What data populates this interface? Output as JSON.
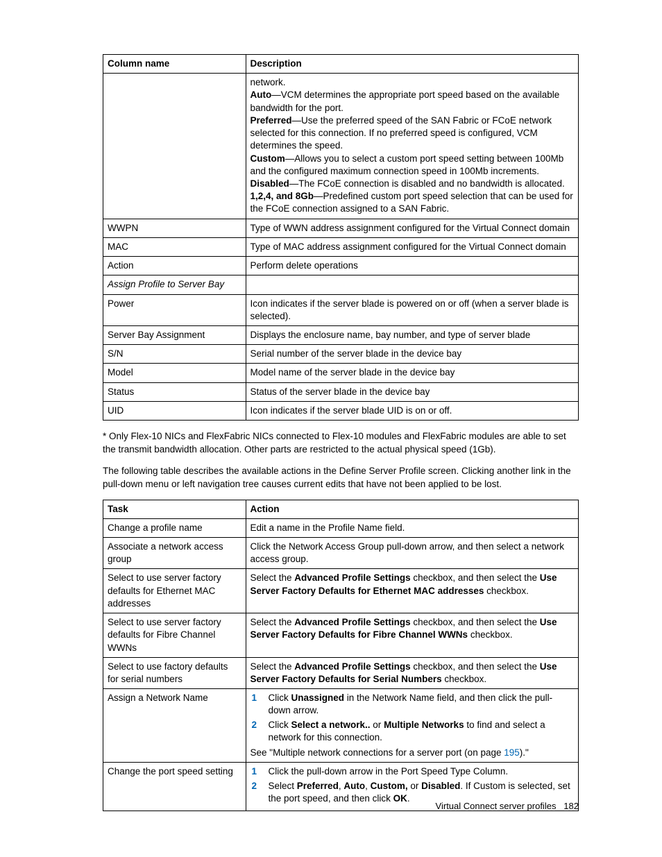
{
  "table1": {
    "headers": {
      "col1": "Column name",
      "col2": "Description"
    },
    "rows": [
      {
        "col1": "",
        "desc_plain1": "network.",
        "auto_label": "Auto",
        "auto_text": "—VCM determines the appropriate port speed based on the available bandwidth for the port.",
        "pref_label": "Preferred",
        "pref_text": "—Use the preferred speed of the SAN Fabric or FCoE network selected for this connection. If no preferred speed is configured, VCM determines the speed.",
        "custom_label": "Custom",
        "custom_text": "—Allows you to select a custom port speed setting between 100Mb and the configured maximum connection speed in 100Mb increments.",
        "disabled_label": "Disabled",
        "disabled_text": "—The FCoE connection is disabled and no bandwidth is allocated.",
        "gb_label": "1,2,4, and 8Gb",
        "gb_text": "—Predefined custom port speed selection that can be used for the FCoE connection assigned to a SAN Fabric."
      },
      {
        "col1": "WWPN",
        "col2": "Type of WWN address assignment configured for the Virtual Connect domain"
      },
      {
        "col1": "MAC",
        "col2": "Type of MAC address assignment configured for the Virtual Connect domain"
      },
      {
        "col1": "Action",
        "col2": "Perform delete operations"
      },
      {
        "col1": "Assign Profile to Server Bay",
        "col2": "",
        "italic": true
      },
      {
        "col1": "Power",
        "col2": "Icon indicates if the server blade is powered on or off (when a server blade is selected)."
      },
      {
        "col1": "Server Bay Assignment",
        "col2": "Displays the enclosure name, bay number, and type of server blade"
      },
      {
        "col1": "S/N",
        "col2": "Serial number of the server blade in the device bay"
      },
      {
        "col1": "Model",
        "col2": "Model name of the server blade in the device bay"
      },
      {
        "col1": "Status",
        "col2": "Status of the server blade in the device bay"
      },
      {
        "col1": "UID",
        "col2": "Icon indicates if the server blade UID is on or off."
      }
    ]
  },
  "note1": "* Only Flex-10 NICs and FlexFabric NICs connected to Flex-10 modules and FlexFabric modules are able to set the transmit bandwidth allocation. Other parts are restricted to the actual physical speed (1Gb).",
  "para2": "The following table describes the available actions in the Define Server Profile screen. Clicking another link in the pull-down menu or left navigation tree causes current edits that have not been applied to be lost.",
  "table2": {
    "headers": {
      "col1": "Task",
      "col2": "Action"
    },
    "rows": {
      "r1": {
        "task": "Change a profile name",
        "action": "Edit a name in the Profile Name field."
      },
      "r2": {
        "task": "Associate a network access group",
        "action": "Click the Network Access Group pull-down arrow, and then select a network access group."
      },
      "r3": {
        "task": "Select to use server factory defaults for Ethernet MAC addresses",
        "pre": "Select the ",
        "b1": "Advanced Profile Settings",
        "mid": " checkbox, and then select the ",
        "b2": "Use Server Factory Defaults for Ethernet MAC addresses",
        "post": " checkbox."
      },
      "r4": {
        "task": "Select to use server factory defaults for Fibre Channel WWNs",
        "pre": "Select the ",
        "b1": "Advanced Profile Settings",
        "mid": " checkbox, and then select the ",
        "b2": "Use Server Factory Defaults for Fibre Channel WWNs",
        "post": " checkbox."
      },
      "r5": {
        "task": "Select to use factory defaults for serial numbers",
        "pre": "Select the ",
        "b1": "Advanced Profile Settings",
        "mid": " checkbox, and then select the ",
        "b2": "Use Server Factory Defaults for Serial Numbers",
        "post": " checkbox."
      },
      "r6": {
        "task": "Assign a Network Name",
        "s1_pre": "Click ",
        "s1_b": "Unassigned",
        "s1_post": " in the Network Name field, and then click the pull-down arrow.",
        "s2_pre": "Click ",
        "s2_b1": "Select a network..",
        "s2_mid": " or ",
        "s2_b2": "Multiple Networks",
        "s2_post": " to find and select a network for this connection.",
        "see_pre": "See \"Multiple network connections for a server port (on page ",
        "see_link": "195",
        "see_post": ").\""
      },
      "r7": {
        "task": "Change the port speed setting",
        "s1": "Click the pull-down arrow in the Port Speed Type Column.",
        "s2_pre": "Select ",
        "s2_b1": "Preferred",
        "s2_c1": ", ",
        "s2_b2": "Auto",
        "s2_c2": ", ",
        "s2_b3": "Custom,",
        "s2_c3": " or ",
        "s2_b4": "Disabled",
        "s2_mid": ". If Custom is selected, set the port speed, and then click ",
        "s2_b5": "OK",
        "s2_post": "."
      }
    }
  },
  "footer": {
    "text": "Virtual Connect server profiles",
    "page": "182"
  }
}
